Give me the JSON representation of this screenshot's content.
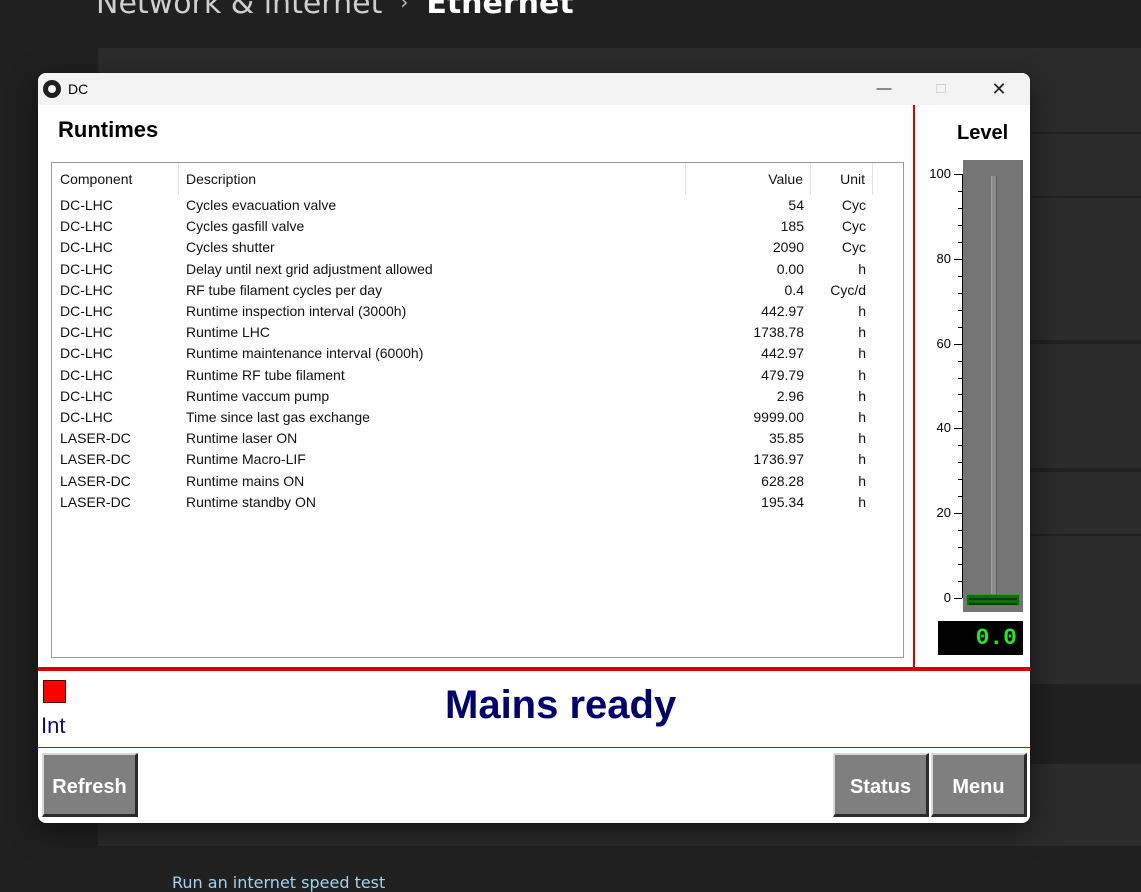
{
  "background": {
    "breadcrumb": [
      "Network & internet",
      "Ethernet"
    ],
    "separator": "›",
    "link": "Run an internet speed test"
  },
  "window": {
    "title": "DC",
    "controls": {
      "minimize": "—",
      "maximize": "□",
      "close": "✕"
    },
    "app_icon": "dc-app-icon"
  },
  "runtimes": {
    "title": "Runtimes",
    "columns": {
      "component": "Component",
      "description": "Description",
      "value": "Value",
      "unit": "Unit"
    },
    "rows": [
      {
        "component": "DC-LHC",
        "description": "Cycles evacuation valve",
        "value": "54",
        "unit": "Cyc"
      },
      {
        "component": "DC-LHC",
        "description": "Cycles gasfill valve",
        "value": "185",
        "unit": "Cyc"
      },
      {
        "component": "DC-LHC",
        "description": "Cycles shutter",
        "value": "2090",
        "unit": "Cyc"
      },
      {
        "component": "DC-LHC",
        "description": "Delay until next grid adjustment allowed",
        "value": "0.00",
        "unit": "h"
      },
      {
        "component": "DC-LHC",
        "description": "RF tube filament cycles per day",
        "value": "0.4",
        "unit": "Cyc/d"
      },
      {
        "component": "DC-LHC",
        "description": "Runtime inspection interval (3000h)",
        "value": "442.97",
        "unit": "h"
      },
      {
        "component": "DC-LHC",
        "description": "Runtime LHC",
        "value": "1738.78",
        "unit": "h"
      },
      {
        "component": "DC-LHC",
        "description": "Runtime maintenance interval (6000h)",
        "value": "442.97",
        "unit": "h"
      },
      {
        "component": "DC-LHC",
        "description": "Runtime RF tube filament",
        "value": "479.79",
        "unit": "h"
      },
      {
        "component": "DC-LHC",
        "description": "Runtime vaccum pump",
        "value": "2.96",
        "unit": "h"
      },
      {
        "component": "DC-LHC",
        "description": "Time since last gas exchange",
        "value": "9999.00",
        "unit": "h"
      },
      {
        "component": "LASER-DC",
        "description": "Runtime laser ON",
        "value": "35.85",
        "unit": "h"
      },
      {
        "component": "LASER-DC",
        "description": "Runtime Macro-LIF",
        "value": "1736.97",
        "unit": "h"
      },
      {
        "component": "LASER-DC",
        "description": "Runtime mains ON",
        "value": "628.28",
        "unit": "h"
      },
      {
        "component": "LASER-DC",
        "description": "Runtime standby ON",
        "value": "195.34",
        "unit": "h"
      }
    ]
  },
  "level": {
    "title": "Level",
    "scale_labels": [
      "100",
      "80",
      "60",
      "40",
      "20",
      "0"
    ],
    "value": 0.0,
    "readout": "0.0",
    "fill_color": "#136c13",
    "readout_color": "#26e626"
  },
  "status": {
    "indicator_color": "#ff0000",
    "indicator_label": "Int",
    "message": "Mains ready",
    "message_color": "#00006e"
  },
  "buttons": {
    "refresh": "Refresh",
    "status": "Status",
    "menu": "Menu"
  }
}
